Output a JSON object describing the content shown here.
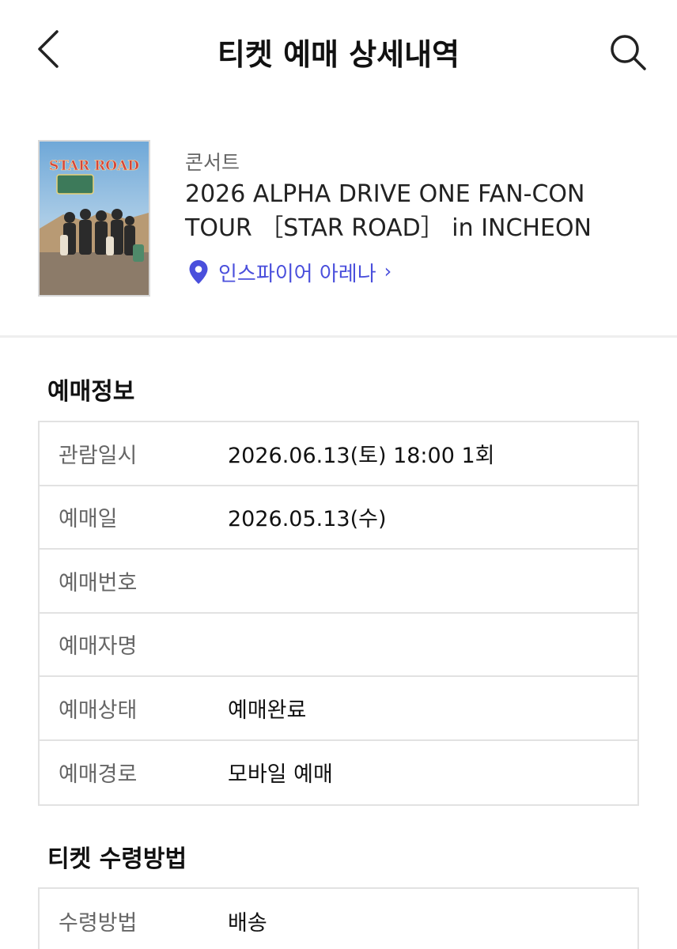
{
  "header": {
    "title": "티켓 예매 상세내역"
  },
  "event": {
    "category": "콘서트",
    "title": "2026 ALPHA DRIVE ONE FAN-CON TOUR ［STAR ROAD］ in INCHEON",
    "venue": "인스파이어 아레나",
    "venue_chevron": "›",
    "poster_text": "STAR ROAD"
  },
  "booking_info": {
    "title": "예매정보",
    "rows": [
      {
        "label": "관람일시",
        "value": "2026.06.13(토) 18:00 1회"
      },
      {
        "label": "예매일",
        "value": "2026.05.13(수)"
      },
      {
        "label": "예매번호",
        "value": ""
      },
      {
        "label": "예매자명",
        "value": ""
      },
      {
        "label": "예매상태",
        "value": "예매완료"
      },
      {
        "label": "예매경로",
        "value": "모바일 예매"
      }
    ]
  },
  "ticket_receipt": {
    "title": "티켓 수령방법",
    "rows": [
      {
        "label": "수령방법",
        "value": "배송"
      }
    ]
  },
  "colors": {
    "accent": "#4a4fdc",
    "label": "#666666",
    "border": "#e2e2e2"
  }
}
